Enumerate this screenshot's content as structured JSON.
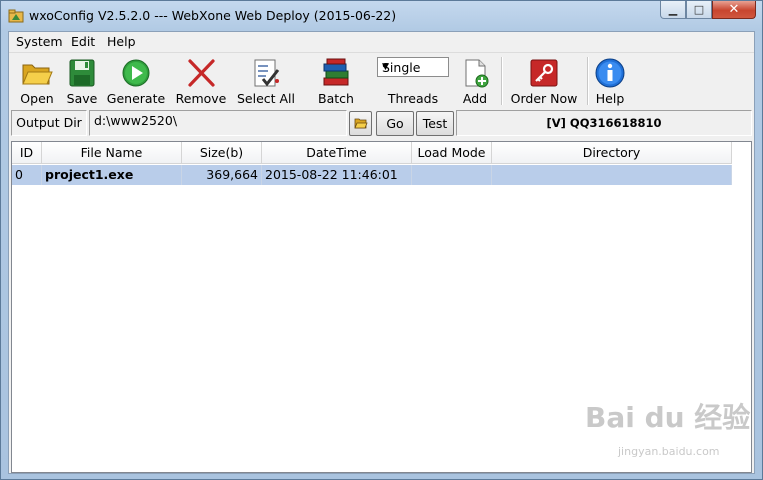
{
  "window": {
    "title": "wxoConfig V2.5.2.0  --- WebXone Web Deploy (2015-06-22)"
  },
  "menu": [
    {
      "label": "System"
    },
    {
      "label": "Edit"
    },
    {
      "label": "Help"
    }
  ],
  "toolbar": {
    "open": "Open",
    "save": "Save",
    "generate": "Generate",
    "remove": "Remove",
    "select_all": "Select All",
    "batch": "Batch",
    "threads": "Threads",
    "threads_value": "Single",
    "add": "Add",
    "order_now": "Order Now",
    "help": "Help"
  },
  "dirbar": {
    "label": "Output Dir",
    "value": "d:\\www2520\\",
    "go": "Go",
    "test": "Test",
    "status": "[V] QQ316618810"
  },
  "table": {
    "columns": [
      "ID",
      "File Name",
      "Size(b)",
      "DateTime",
      "Load Mode",
      "Directory"
    ],
    "rows": [
      {
        "id": "0",
        "file": "project1.exe",
        "size": "369,664",
        "datetime": "2015-08-22 11:46:01",
        "mode": "",
        "dir": ""
      }
    ]
  },
  "watermark": {
    "main": "Bai du 经验",
    "sub": "jingyan.baidu.com"
  },
  "colors": {
    "selection": "#b9cdea",
    "close_button": "#c8452f"
  },
  "icons": [
    "folder-open-icon",
    "floppy-save-icon",
    "play-generate-icon",
    "x-remove-icon",
    "checklist-select-icon",
    "books-batch-icon",
    "document-add-icon",
    "key-order-icon",
    "info-help-icon"
  ]
}
